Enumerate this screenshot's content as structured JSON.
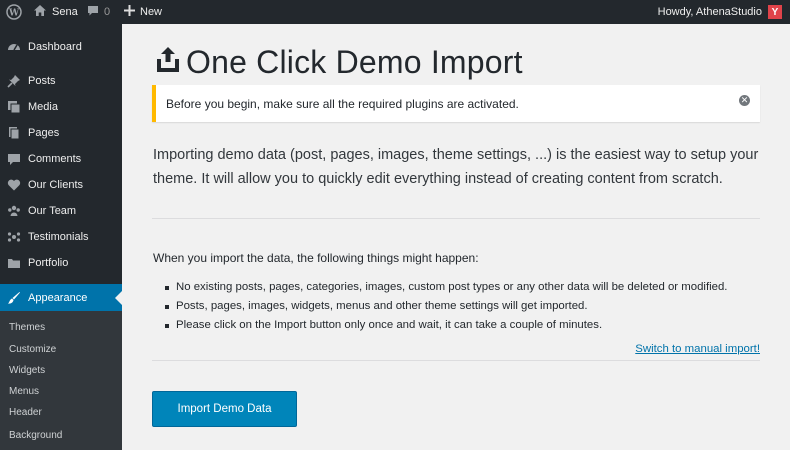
{
  "adminbar": {
    "site_name": "Sena",
    "comments_count": "0",
    "new_label": "New",
    "howdy": "Howdy, AthenaStudio",
    "avatar_letter": "Y"
  },
  "sidebar": {
    "items": [
      {
        "label": "Dashboard",
        "icon": "dashboard-icon"
      },
      {
        "label": "Posts",
        "icon": "pin-icon"
      },
      {
        "label": "Media",
        "icon": "media-icon"
      },
      {
        "label": "Pages",
        "icon": "pages-icon"
      },
      {
        "label": "Comments",
        "icon": "comment-icon"
      },
      {
        "label": "Our Clients",
        "icon": "heart-icon"
      },
      {
        "label": "Our Team",
        "icon": "groups-icon"
      },
      {
        "label": "Testimonials",
        "icon": "testimonials-icon"
      },
      {
        "label": "Portfolio",
        "icon": "portfolio-icon"
      },
      {
        "label": "Appearance",
        "icon": "brush-icon"
      }
    ],
    "submenu": [
      "Themes",
      "Customize",
      "Widgets",
      "Menus",
      "Header",
      "Background"
    ]
  },
  "main": {
    "title": "One Click Demo Import",
    "notice": "Before you begin, make sure all the required plugins are activated.",
    "intro": "Importing demo data (post, pages, images, theme settings, ...) is the easiest way to setup your theme. It will allow you to quickly edit everything instead of creating content from scratch.",
    "happen_heading": "When you import the data, the following things might happen:",
    "bullets": [
      "No existing posts, pages, categories, images, custom post types or any other data will be deleted or modified.",
      "Posts, pages, images, widgets, menus and other theme settings will get imported.",
      "Please click on the Import button only once and wait, it can take a couple of minutes."
    ],
    "manual_link": "Switch to manual import!",
    "import_button": "Import Demo Data"
  },
  "colors": {
    "admin_dark": "#23282d",
    "submenu_bg": "#32373c",
    "accent": "#0073aa",
    "button": "#0085ba",
    "notice_warning": "#ffb900"
  }
}
